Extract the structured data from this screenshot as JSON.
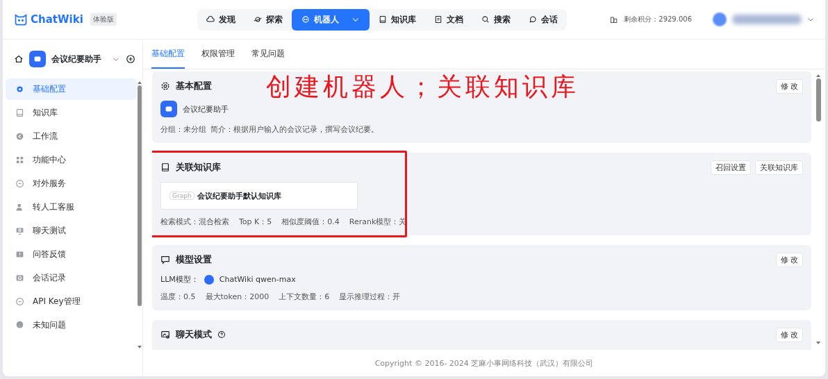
{
  "app": {
    "logo": "ChatWiki",
    "edition": "体验版"
  },
  "nav": [
    {
      "label": "发现",
      "selected": false,
      "dropdown": false
    },
    {
      "label": "探索",
      "selected": false,
      "dropdown": false
    },
    {
      "label": "机器人",
      "selected": true,
      "dropdown": true
    },
    {
      "label": "知识库",
      "selected": false,
      "dropdown": false
    },
    {
      "label": "文档",
      "selected": false,
      "dropdown": false
    },
    {
      "label": "搜索",
      "selected": false,
      "dropdown": false
    },
    {
      "label": "会话",
      "selected": false,
      "dropdown": false
    }
  ],
  "account": {
    "points": "剩余积分：2929.006"
  },
  "robot": {
    "name": "会议纪要助手"
  },
  "sidebar": {
    "items": [
      {
        "label": "基础配置",
        "selected": true
      },
      {
        "label": "知识库",
        "selected": false
      },
      {
        "label": "工作流",
        "selected": false
      },
      {
        "label": "功能中心",
        "selected": false
      },
      {
        "label": "对外服务",
        "selected": false
      },
      {
        "label": "转人工客服",
        "selected": false
      },
      {
        "label": "聊天测试",
        "selected": false
      },
      {
        "label": "问答反馈",
        "selected": false
      },
      {
        "label": "会话记录",
        "selected": false
      },
      {
        "label": "API Key管理",
        "selected": false
      },
      {
        "label": "未知问题",
        "selected": false
      }
    ]
  },
  "tabs": [
    {
      "label": "基础配置",
      "selected": true
    },
    {
      "label": "权限管理",
      "selected": false
    },
    {
      "label": "常见问题",
      "selected": false
    }
  ],
  "annotation": {
    "text": "创建机器人；关联知识库"
  },
  "sections": [
    {
      "kind": "basic",
      "title": "基本配置",
      "highlighted": false,
      "buttons": [
        "修 改"
      ],
      "robot_name": "会议纪要助手",
      "details": [
        "分组：未分组",
        "简介：根据用户输入的会议记录，撰写会议纪要。"
      ]
    },
    {
      "kind": "knowledge",
      "title": "关联知识库",
      "highlighted": true,
      "buttons": [
        "召回设置",
        "关联知识库"
      ],
      "library": {
        "tag": "Graph",
        "name": "会议纪要助手默认知识库"
      },
      "details": [
        "检索模式：混合检索",
        "Top K：5",
        "相似度阈值：0.4",
        "Rerank模型：关"
      ]
    },
    {
      "kind": "model",
      "title": "模型设置",
      "highlighted": false,
      "buttons": [
        "修 改"
      ],
      "model": {
        "label": "LLM模型：",
        "name": "ChatWiki qwen-max"
      },
      "details": [
        "温度：0.5",
        "最大token：2000",
        "上下文数量：6",
        "显示推理过程：开"
      ]
    },
    {
      "kind": "chat",
      "title": "聊天模式",
      "highlighted": false,
      "help": true,
      "buttons": [
        "修 改"
      ]
    }
  ],
  "footer": "Copyright © 2016- 2024 芝麻小事网络科技（武汉）有限公司"
}
